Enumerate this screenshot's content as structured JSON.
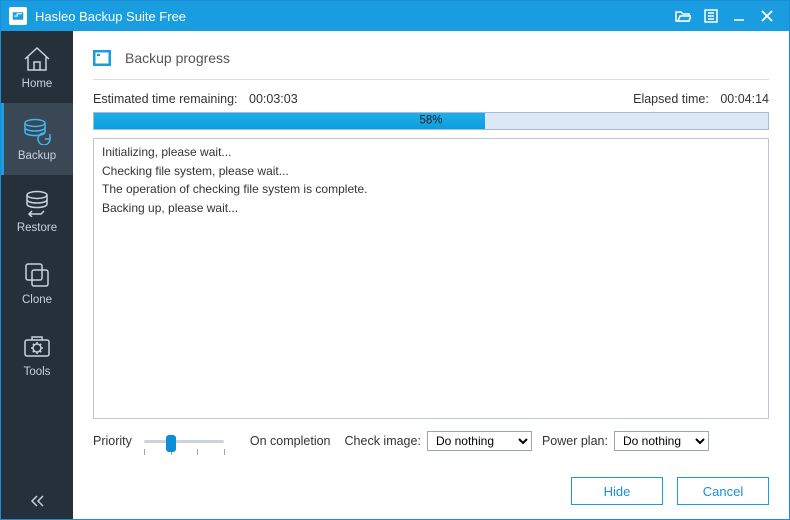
{
  "app": {
    "title": "Hasleo Backup Suite Free"
  },
  "sidebar": {
    "items": [
      {
        "label": "Home"
      },
      {
        "label": "Backup"
      },
      {
        "label": "Restore"
      },
      {
        "label": "Clone"
      },
      {
        "label": "Tools"
      }
    ]
  },
  "page": {
    "title": "Backup progress"
  },
  "times": {
    "remaining_label": "Estimated time remaining:",
    "remaining_value": "00:03:03",
    "elapsed_label": "Elapsed time:",
    "elapsed_value": "00:04:14"
  },
  "progress": {
    "percent": 58,
    "percent_text": "58%"
  },
  "log": [
    "Initializing, please wait...",
    "Checking file system, please wait...",
    "The operation of checking file system is complete.",
    "Backing up, please wait..."
  ],
  "options": {
    "priority_label": "Priority",
    "priority_value": 1,
    "priority_max": 3,
    "on_completion_label": "On completion",
    "check_image_label": "Check image:",
    "check_image_value": "Do nothing",
    "power_plan_label": "Power plan:",
    "power_plan_value": "Do nothing"
  },
  "actions": {
    "hide": "Hide",
    "cancel": "Cancel"
  }
}
